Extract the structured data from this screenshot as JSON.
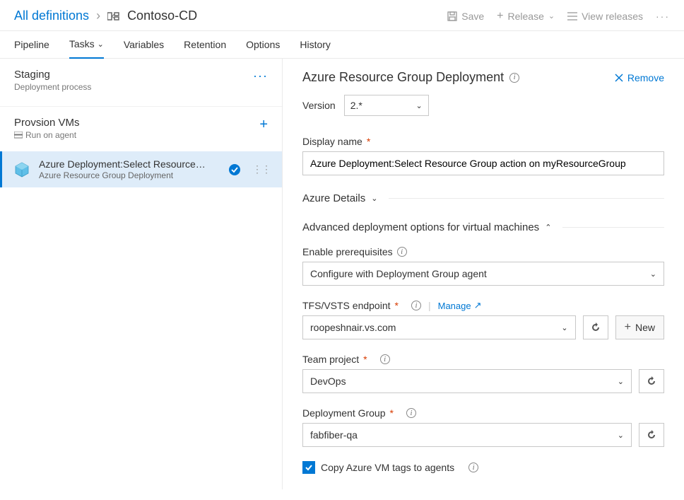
{
  "breadcrumb": {
    "root": "All definitions",
    "title": "Contoso-CD"
  },
  "topActions": {
    "save": "Save",
    "release": "Release",
    "viewReleases": "View releases"
  },
  "tabs": {
    "pipeline": "Pipeline",
    "tasks": "Tasks",
    "variables": "Variables",
    "retention": "Retention",
    "options": "Options",
    "history": "History"
  },
  "stage": {
    "title": "Staging",
    "subtitle": "Deployment process"
  },
  "agent": {
    "title": "Provsion VMs",
    "subtitle": "Run on agent"
  },
  "task": {
    "title": "Azure Deployment:Select Resource…",
    "subtitle": "Azure Resource Group Deployment"
  },
  "panel": {
    "title": "Azure Resource Group Deployment",
    "remove": "Remove",
    "versionLabel": "Version",
    "versionValue": "2.*",
    "displayNameLabel": "Display name",
    "displayNameValue": "Azure Deployment:Select Resource Group action on myResourceGroup",
    "sectionAzure": "Azure Details",
    "sectionAdvanced": "Advanced deployment options for virtual machines",
    "prereqLabel": "Enable prerequisites",
    "prereqValue": "Configure with Deployment Group agent",
    "endpointLabel": "TFS/VSTS endpoint",
    "manage": "Manage",
    "endpointValue": "roopeshnair.vs.com",
    "newBtn": "New",
    "teamProjectLabel": "Team project",
    "teamProjectValue": "DevOps",
    "depGroupLabel": "Deployment Group",
    "depGroupValue": "fabfiber-qa",
    "copyTagsLabel": "Copy Azure VM tags to agents"
  }
}
